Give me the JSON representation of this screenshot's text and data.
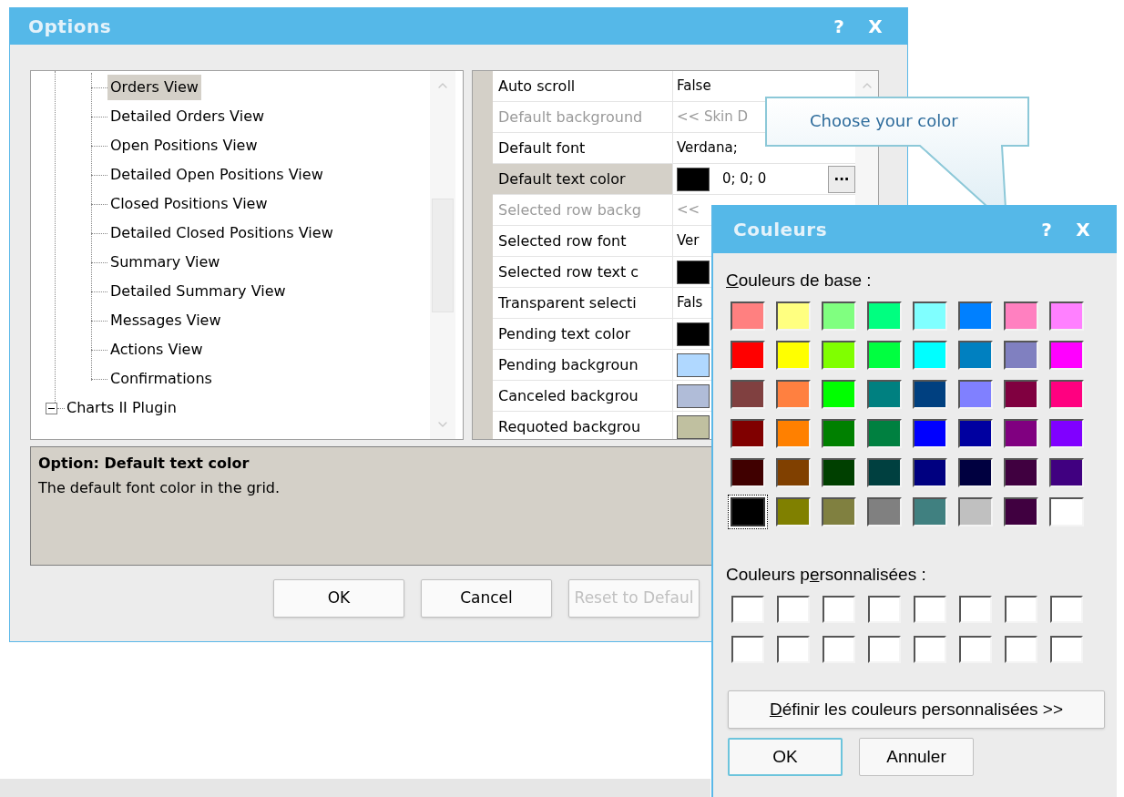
{
  "options_window": {
    "title": "Options",
    "help_glyph": "?",
    "close_glyph": "X"
  },
  "tree": [
    {
      "children": [
        {
          "label": "Orders View",
          "selected": true
        },
        {
          "label": "Detailed Orders View",
          "selected": false
        },
        {
          "label": "Open Positions View",
          "selected": false
        },
        {
          "label": "Detailed Open Positions View",
          "selected": false
        },
        {
          "label": "Closed Positions View",
          "selected": false
        },
        {
          "label": "Detailed Closed Positions View",
          "selected": false
        },
        {
          "label": "Summary View",
          "selected": false
        },
        {
          "label": "Detailed Summary View",
          "selected": false
        },
        {
          "label": "Messages View",
          "selected": false
        },
        {
          "label": "Actions View",
          "selected": false
        },
        {
          "label": "Confirmations",
          "selected": false
        }
      ]
    },
    {
      "label": "Charts II Plugin",
      "expanded": true,
      "selected": false
    }
  ],
  "properties": [
    {
      "name": "Auto scroll",
      "kind": "text",
      "value": "False",
      "disabled": false,
      "selected": false
    },
    {
      "name": "Default background",
      "kind": "text",
      "value": "<< Skin D",
      "disabled": true,
      "selected": false
    },
    {
      "name": "Default font",
      "kind": "text",
      "value": "Verdana;",
      "disabled": false,
      "selected": false
    },
    {
      "name": "Default text color",
      "kind": "color",
      "color": "#000000",
      "value": "0; 0; 0",
      "button": "...",
      "disabled": false,
      "selected": true
    },
    {
      "name": "Selected row backg",
      "kind": "text",
      "value": "<<",
      "disabled": true,
      "selected": false
    },
    {
      "name": "Selected row font",
      "kind": "text",
      "value": "Ver",
      "disabled": false,
      "selected": false
    },
    {
      "name": "Selected row text c",
      "kind": "color",
      "color": "#000000",
      "disabled": false,
      "selected": false
    },
    {
      "name": "Transparent selecti",
      "kind": "text",
      "value": "Fals",
      "disabled": false,
      "selected": false
    },
    {
      "name": "Pending text color",
      "kind": "color",
      "color": "#000000",
      "disabled": false,
      "selected": false
    },
    {
      "name": "Pending backgroun",
      "kind": "color",
      "color": "#b0d8ff",
      "disabled": false,
      "selected": false
    },
    {
      "name": "Canceled backgrou",
      "kind": "color",
      "color": "#b0bcd8",
      "disabled": false,
      "selected": false
    },
    {
      "name": "Requoted backgrou",
      "kind": "color",
      "color": "#c0c0a0",
      "disabled": false,
      "selected": false
    }
  ],
  "description": {
    "title": "Option: Default text color",
    "text": "The default font color in the grid."
  },
  "buttons": [
    {
      "label": "OK",
      "disabled": false
    },
    {
      "label": "Cancel",
      "disabled": false
    },
    {
      "label": "Reset to Defaul",
      "disabled": true
    }
  ],
  "callout": {
    "text": "Choose your color"
  },
  "color_dialog": {
    "title": "Couleurs",
    "help_glyph": "?",
    "close_glyph": "X",
    "base_label": [
      {
        "text": "C",
        "underlined": true
      },
      {
        "text": "ouleurs de base :",
        "underlined": false
      }
    ],
    "base_colors": [
      [
        {
          "color": "#ff8080",
          "selected": false
        },
        {
          "color": "#ffff80",
          "selected": false
        },
        {
          "color": "#80ff80",
          "selected": false
        },
        {
          "color": "#00ff80",
          "selected": false
        },
        {
          "color": "#80ffff",
          "selected": false
        },
        {
          "color": "#0080ff",
          "selected": false
        },
        {
          "color": "#ff80c0",
          "selected": false
        },
        {
          "color": "#ff80ff",
          "selected": false
        }
      ],
      [
        {
          "color": "#ff0000",
          "selected": false
        },
        {
          "color": "#ffff00",
          "selected": false
        },
        {
          "color": "#80ff00",
          "selected": false
        },
        {
          "color": "#00ff40",
          "selected": false
        },
        {
          "color": "#00ffff",
          "selected": false
        },
        {
          "color": "#0080c0",
          "selected": false
        },
        {
          "color": "#8080c0",
          "selected": false
        },
        {
          "color": "#ff00ff",
          "selected": false
        }
      ],
      [
        {
          "color": "#804040",
          "selected": false
        },
        {
          "color": "#ff8040",
          "selected": false
        },
        {
          "color": "#00ff00",
          "selected": false
        },
        {
          "color": "#008080",
          "selected": false
        },
        {
          "color": "#004080",
          "selected": false
        },
        {
          "color": "#8080ff",
          "selected": false
        },
        {
          "color": "#800040",
          "selected": false
        },
        {
          "color": "#ff0080",
          "selected": false
        }
      ],
      [
        {
          "color": "#800000",
          "selected": false
        },
        {
          "color": "#ff8000",
          "selected": false
        },
        {
          "color": "#008000",
          "selected": false
        },
        {
          "color": "#008040",
          "selected": false
        },
        {
          "color": "#0000ff",
          "selected": false
        },
        {
          "color": "#0000a0",
          "selected": false
        },
        {
          "color": "#800080",
          "selected": false
        },
        {
          "color": "#8000ff",
          "selected": false
        }
      ],
      [
        {
          "color": "#400000",
          "selected": false
        },
        {
          "color": "#804000",
          "selected": false
        },
        {
          "color": "#004000",
          "selected": false
        },
        {
          "color": "#004040",
          "selected": false
        },
        {
          "color": "#000080",
          "selected": false
        },
        {
          "color": "#000040",
          "selected": false
        },
        {
          "color": "#400040",
          "selected": false
        },
        {
          "color": "#400080",
          "selected": false
        }
      ],
      [
        {
          "color": "#000000",
          "selected": true
        },
        {
          "color": "#808000",
          "selected": false
        },
        {
          "color": "#808040",
          "selected": false
        },
        {
          "color": "#808080",
          "selected": false
        },
        {
          "color": "#408080",
          "selected": false
        },
        {
          "color": "#c0c0c0",
          "selected": false
        },
        {
          "color": "#400040",
          "selected": false
        },
        {
          "color": "#ffffff",
          "selected": false
        }
      ]
    ],
    "custom_label": [
      {
        "text": "Couleurs p",
        "underlined": false
      },
      {
        "text": "e",
        "underlined": true
      },
      {
        "text": "rsonnalisées :",
        "underlined": false
      }
    ],
    "custom_colors": [
      [
        {
          "color": "#ffffff"
        },
        {
          "color": "#ffffff"
        },
        {
          "color": "#ffffff"
        },
        {
          "color": "#ffffff"
        },
        {
          "color": "#ffffff"
        },
        {
          "color": "#ffffff"
        },
        {
          "color": "#ffffff"
        },
        {
          "color": "#ffffff"
        }
      ],
      [
        {
          "color": "#ffffff"
        },
        {
          "color": "#ffffff"
        },
        {
          "color": "#ffffff"
        },
        {
          "color": "#ffffff"
        },
        {
          "color": "#ffffff"
        },
        {
          "color": "#ffffff"
        },
        {
          "color": "#ffffff"
        },
        {
          "color": "#ffffff"
        }
      ]
    ],
    "define_button": [
      {
        "text": "D",
        "underlined": true
      },
      {
        "text": "éfinir les couleurs personnalisées >>",
        "underlined": false
      }
    ],
    "buttons": [
      {
        "label": "OK",
        "default": true
      },
      {
        "label": "Annuler",
        "default": false
      }
    ]
  }
}
